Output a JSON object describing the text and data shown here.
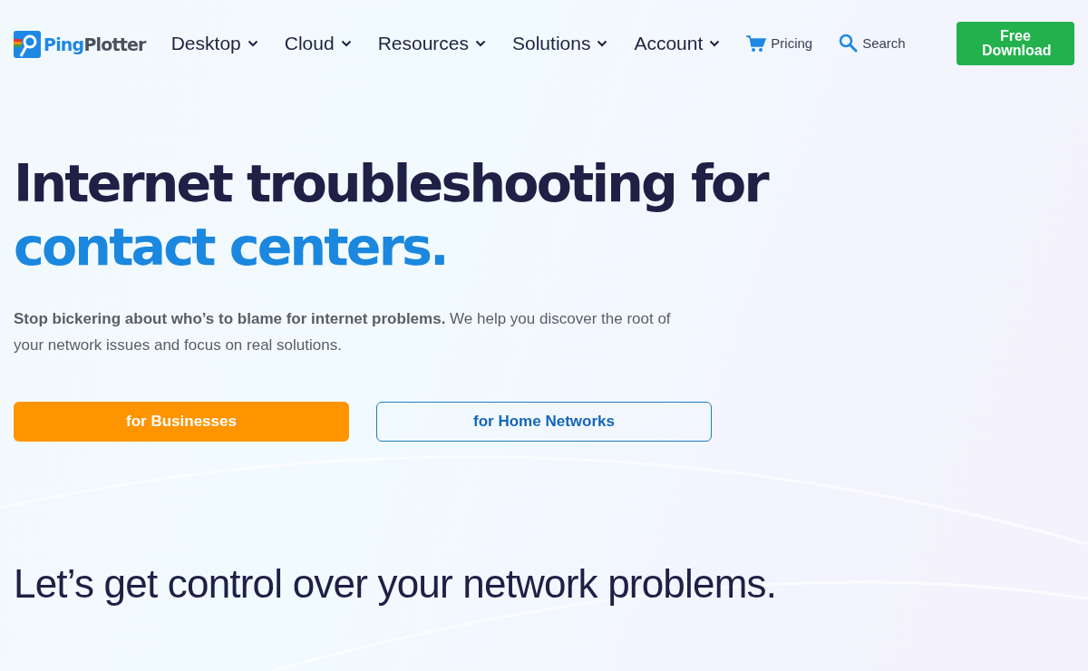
{
  "logo": {
    "part_1": "Ping",
    "part_2": "Plotter"
  },
  "nav": [
    {
      "label": "Desktop",
      "kind": "dropdown"
    },
    {
      "label": "Cloud",
      "kind": "dropdown"
    },
    {
      "label": "Resources",
      "kind": "dropdown"
    },
    {
      "label": "Solutions",
      "kind": "dropdown"
    },
    {
      "label": "Account",
      "kind": "dropdown"
    },
    {
      "label": "Pricing",
      "kind": "cart"
    },
    {
      "label": "Search",
      "kind": "search"
    }
  ],
  "cta": {
    "label": "Free Download"
  },
  "hero": {
    "title_line_1": "Internet troubleshooting for",
    "title_line_2": "contact centers.",
    "lead": "**Stop bickering about who’s to blame for internet problems.** We help you discover the root of your network issues and focus on real solutions.",
    "buttons": [
      {
        "label": "for Businesses",
        "kind": "primary"
      },
      {
        "label": "for Home Networks",
        "kind": "outline"
      }
    ]
  },
  "section_title": "Let’s get control over your network problems."
}
